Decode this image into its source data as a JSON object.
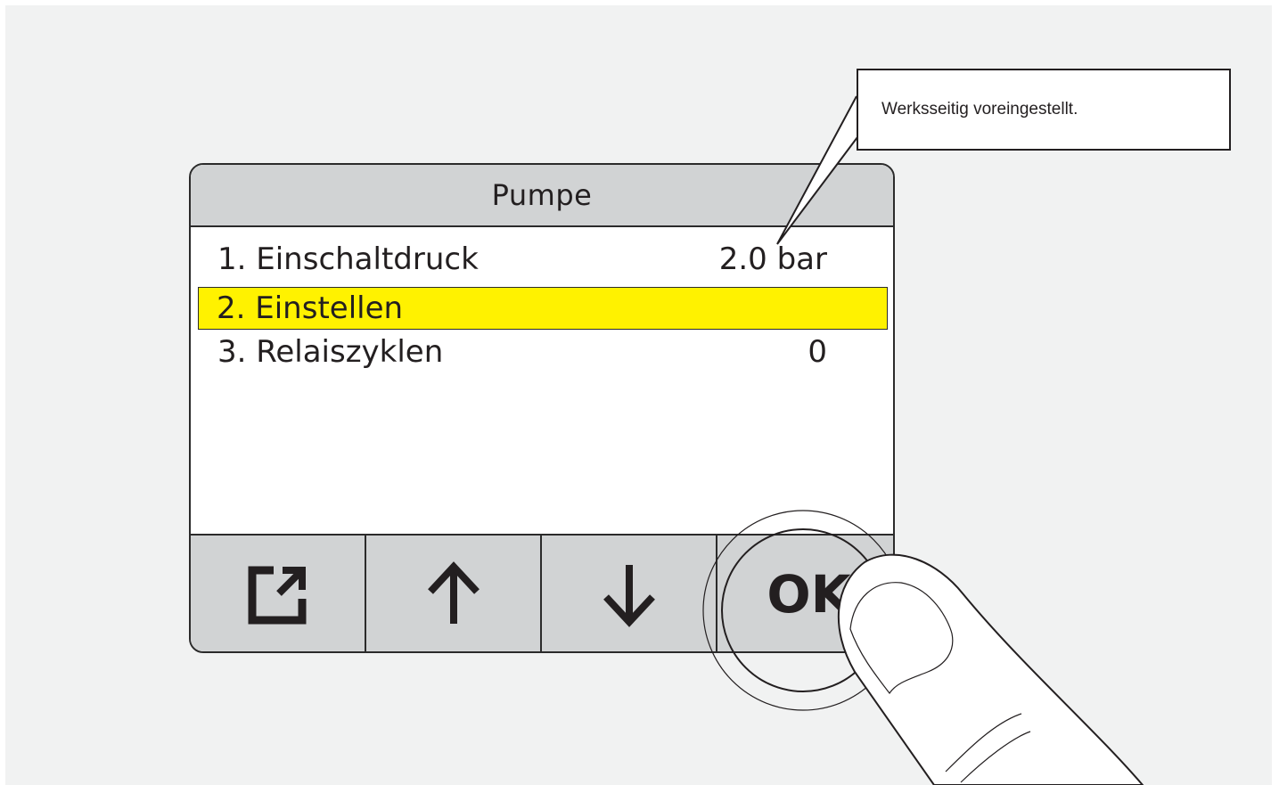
{
  "screen": {
    "title": "Pumpe",
    "menu_items": [
      {
        "label": "1. Einschaltdruck",
        "value": "2.0 bar",
        "selected": false
      },
      {
        "label": "2. Einstellen",
        "value": "",
        "selected": true
      },
      {
        "label": "3. Relaiszyklen",
        "value": "0",
        "selected": false
      }
    ]
  },
  "buttons": {
    "back_icon": "exit-icon",
    "up_icon": "arrow-up-icon",
    "down_icon": "arrow-down-icon",
    "ok_label": "OK"
  },
  "callout": {
    "text": "Werksseitig voreingestellt."
  },
  "colors": {
    "selection": "#fff200",
    "button_bar": "#d1d3d4",
    "background": "#f1f2f2"
  }
}
